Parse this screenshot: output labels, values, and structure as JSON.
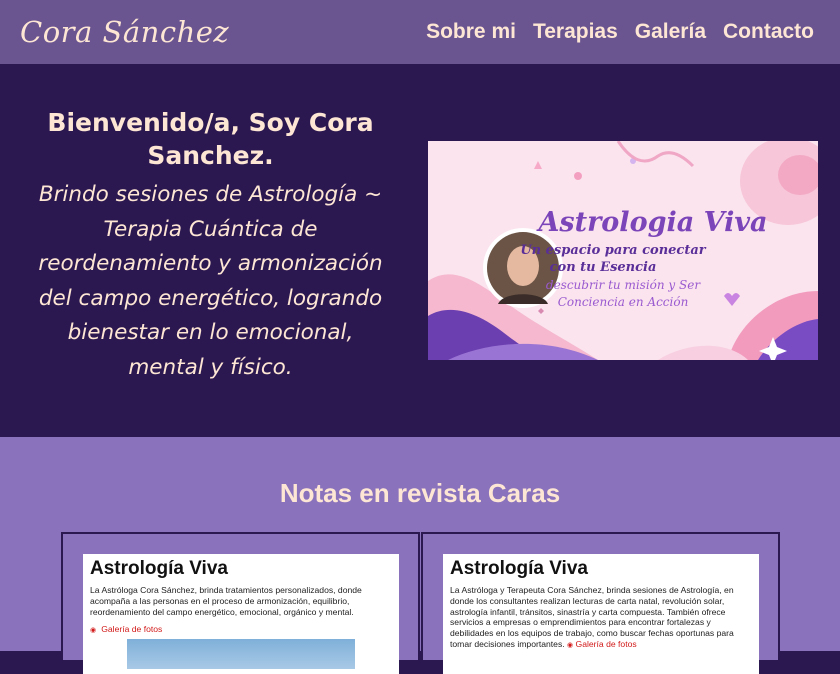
{
  "header": {
    "logo": "Cora Sánchez",
    "nav": [
      {
        "label": "Sobre mi"
      },
      {
        "label": "Terapias"
      },
      {
        "label": "Galería"
      },
      {
        "label": "Contacto"
      }
    ]
  },
  "hero": {
    "title": "Bienvenido/a, Soy Cora Sanchez.",
    "description": "Brindo sesiones de Astrología ~ Terapia Cuántica de reordenamiento y armonización del campo energético, logrando bienestar en lo emocional, mental y físico.",
    "banner": {
      "title": "Astrologia Viva",
      "line1": "Un espacio para conectar",
      "line2": "con tu Esencia",
      "line3": "descubrir tu misión y Ser",
      "line4": "Conciencia en Acción"
    }
  },
  "notes": {
    "title": "Notas en revista Caras",
    "cards": [
      {
        "title": "Astrología Viva",
        "body": "La Astróloga Cora Sánchez, brinda tratamientos personalizados, donde acompaña a las personas en el proceso de armonización, equilibrio, reordenamiento del campo energético, emocional, orgánico y mental.",
        "link": "Galería de fotos"
      },
      {
        "title": "Astrología Viva",
        "body": "La Astróloga y Terapeuta Cora Sánchez, brinda sesiones de Astrología, en donde los consultantes realizan lecturas de carta natal, revolución solar, astrología infantil, tránsitos, sinastría y carta compuesta. También ofrece servicios a empresas o emprendimientos para encontrar fortalezas y debilidades en los equipos de trabajo, como buscar fechas oportunas para tomar decisiones importantes.",
        "link": "Galería de fotos"
      }
    ]
  },
  "colors": {
    "header_bg": "#6a5591",
    "hero_bg": "#2c1850",
    "notes_bg": "#8a73bc",
    "accent_text": "#fde6d4",
    "link_red": "#d21a1a"
  }
}
